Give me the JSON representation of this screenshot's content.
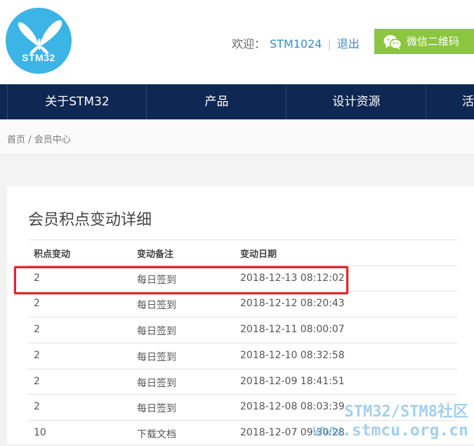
{
  "header": {
    "logo_text": "STM32",
    "welcome_label": "欢迎：",
    "username": "STM1024",
    "separator": "|",
    "logout_label": "退出",
    "wechat_label": "微信二维码"
  },
  "nav": {
    "items": [
      "关于STM32",
      "产品",
      "设计资源",
      "活"
    ]
  },
  "breadcrumb": {
    "home": "首页",
    "separator": "/",
    "current": "会员中心"
  },
  "points": {
    "title": "会员积点变动详细",
    "columns": [
      "积点变动",
      "变动备注",
      "变动日期"
    ],
    "rows": [
      {
        "change": "2",
        "note": "每日签到",
        "date": "2018-12-13 08:12:02"
      },
      {
        "change": "2",
        "note": "每日签到",
        "date": "2018-12-12 08:20:43"
      },
      {
        "change": "2",
        "note": "每日签到",
        "date": "2018-12-11 08:00:07"
      },
      {
        "change": "2",
        "note": "每日签到",
        "date": "2018-12-10 08:32:58"
      },
      {
        "change": "2",
        "note": "每日签到",
        "date": "2018-12-09 18:41:51"
      },
      {
        "change": "2",
        "note": "每日签到",
        "date": "2018-12-08 08:03:39"
      },
      {
        "change": "10",
        "note": "下载文档",
        "date": "2018-12-07 09:30:28"
      }
    ]
  },
  "watermark": {
    "line1": "STM32/STM8社区",
    "line2": "www.stmcu.org.cn"
  },
  "colors": {
    "nav_bg": "#0e2753",
    "logo_blue": "#3cb4e5",
    "wechat_green": "#8cc63f",
    "link_blue": "#3a8fc7",
    "highlight_red": "#e2262b"
  }
}
